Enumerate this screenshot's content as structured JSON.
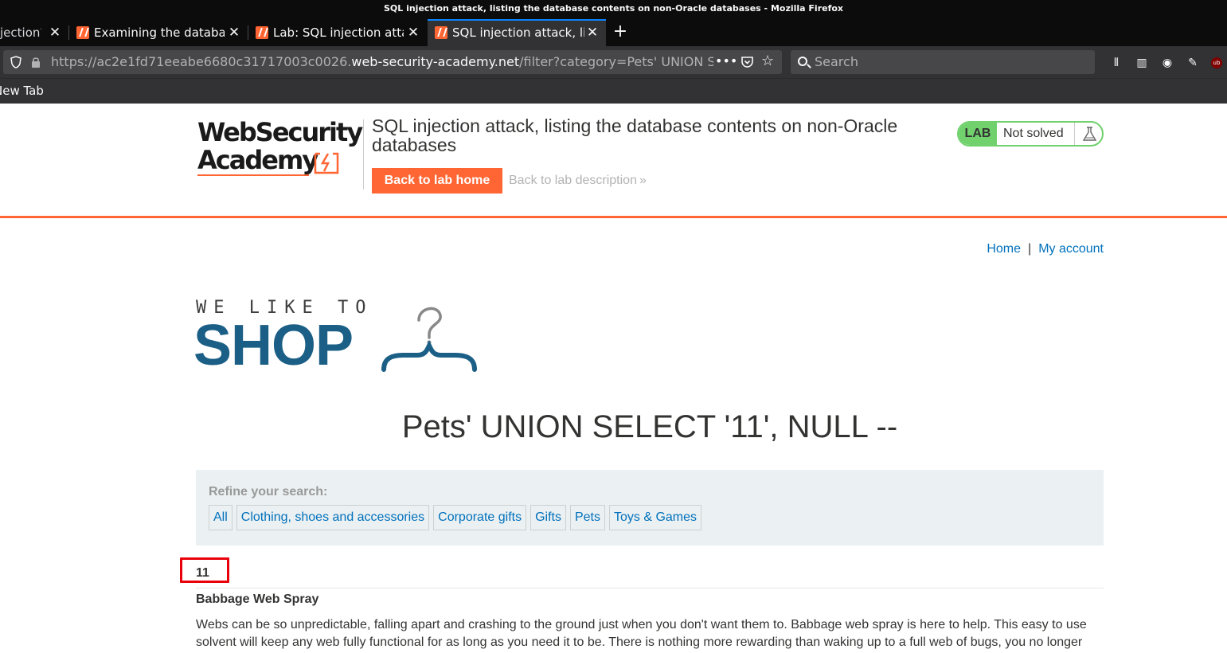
{
  "browser": {
    "window_title": "SQL injection attack, listing the database contents on non-Oracle databases - Mozilla Firefox",
    "tabs": [
      {
        "label": "jection?",
        "active": false
      },
      {
        "label": "Examining the databas",
        "active": false
      },
      {
        "label": "Lab: SQL injection atta",
        "active": false
      },
      {
        "label": "SQL injection attack, lis",
        "active": true
      }
    ],
    "url": {
      "prefix": "https://ac2e1fd71eeabe6680c31717003c0026.",
      "host": "web-security-academy.net",
      "path": "/filter?category=Pets' UNION SELECT"
    },
    "search_placeholder": "Search",
    "bookmark": "New Tab"
  },
  "lab_header": {
    "logo_line1": "WebSecurity",
    "logo_line2": "Academy",
    "title": "SQL injection attack, listing the database contents on non-Oracle databases",
    "back_home_label": "Back to lab home",
    "back_description_label": "Back to lab description",
    "status_tag": "LAB",
    "status_text": "Not solved"
  },
  "nav": {
    "home": "Home",
    "separator": "|",
    "account": "My account"
  },
  "shop_logo": {
    "tagline": "WE LIKE TO",
    "word": "SHOP"
  },
  "category_title": "Pets' UNION SELECT '11', NULL --",
  "filters": {
    "heading": "Refine your search:",
    "categories": [
      "All",
      "Clothing, shoes and accessories",
      "Corporate gifts",
      "Gifts",
      "Pets",
      "Toys & Games"
    ]
  },
  "results": {
    "injected_value": "11",
    "product_name": "Babbage Web Spray",
    "product_description": "Webs can be so unpredictable, falling apart and crashing to the ground just when you don't want them to. Babbage web spray is here to help. This easy to use solvent will keep any web fully functional for as long as you need it to be. There is nothing more rewarding than waking up to a full web of bugs, you no longer"
  },
  "colors": {
    "accent_orange": "#ff6633",
    "link_blue": "#0071bc",
    "shop_blue": "#1b5f86",
    "lab_green": "#70d16d",
    "highlight_red": "#e8000b"
  }
}
